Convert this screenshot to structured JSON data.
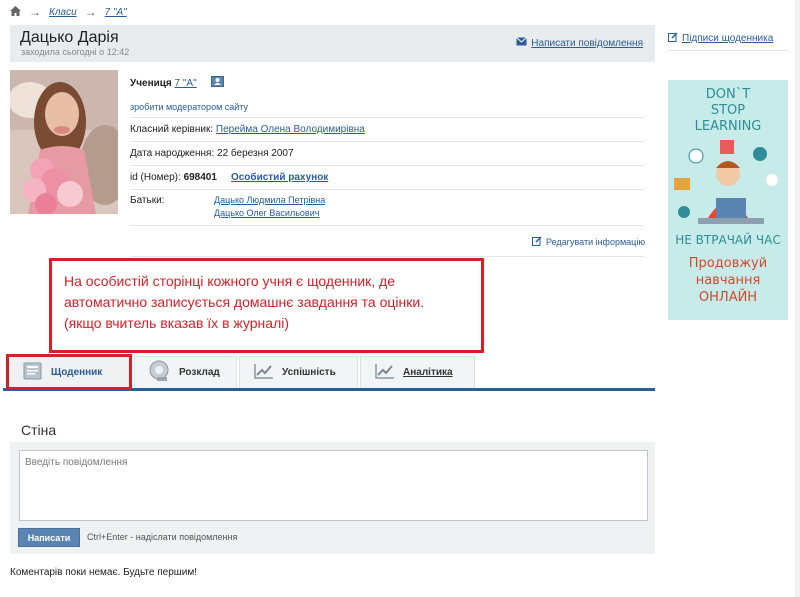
{
  "breadcrumb": {
    "item1": "Класи",
    "item2": "7 \"А\""
  },
  "header": {
    "name": "Дацько Дарія",
    "last_seen": "заходила сьогодні о 12:42",
    "message_link": "Написати повідомлення"
  },
  "info": {
    "role_label": "Учениця",
    "role_class": "7 \"А\"",
    "moderator_link": "зробити модератором сайту",
    "teacher_label": "Класний керівник:",
    "teacher_name": "Перейма Олена Володимирівна",
    "birth_label": "Дата народження:",
    "birth_date": "22 березня 2007",
    "id_label": "id (Номер):",
    "id_value": "698401",
    "account_link": "Особистий рахунок",
    "parents_label": "Батьки:",
    "parent1": "Дацько Людмила Петрівна",
    "parent2": "Дацько Олег Васильович",
    "edit_link": "Редагувати інформацію"
  },
  "callout": {
    "line1": "На особистій сторінці кожного учня є щоденник, де",
    "line2": "автоматично записується домашнє завдання та оцінки.",
    "line3": "(якщо вчитель вказав їх в журналі)"
  },
  "tabs": [
    {
      "label": "Щоденник"
    },
    {
      "label": "Розклад"
    },
    {
      "label": "Успішність"
    },
    {
      "label": "Аналітика"
    }
  ],
  "wall": {
    "title": "Стіна",
    "placeholder": "Введіть повідомлення",
    "send_label": "Написати",
    "hint": "Ctrl+Enter - надіслати повідомлення",
    "no_comments": "Коментарів поки немає. Будьте першим!"
  },
  "sidebar": {
    "signatures_link": "Підписи щоденника"
  },
  "ad": {
    "line1": "DON`T",
    "line2": "STOP",
    "line3": "LEARNING",
    "line4": "НЕ ВТРАЧАЙ ЧАС",
    "line5": "Продовжуй",
    "line6": "навчання",
    "line7": "ОНЛАЙН"
  },
  "colors": {
    "accent": "#2a5d99",
    "callout": "#d61f26",
    "ad_bg": "#c6ebe9",
    "ad_text": "#2f8d99"
  }
}
